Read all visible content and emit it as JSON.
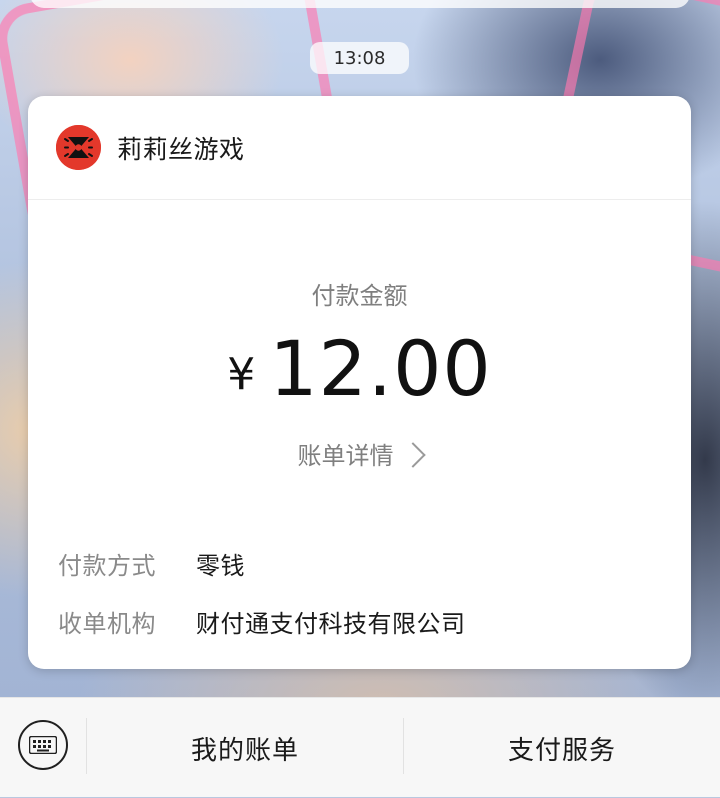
{
  "status": {
    "time": "13:08"
  },
  "card": {
    "merchant_name": "莉莉丝游戏",
    "amount_label": "付款金额",
    "currency_symbol": "¥",
    "amount": "12.00",
    "details_link": "账单详情",
    "rows": [
      {
        "label": "付款方式",
        "value": "零钱"
      },
      {
        "label": "收单机构",
        "value": "财付通支付科技有限公司"
      }
    ]
  },
  "bottom_bar": {
    "keyboard_icon": "keyboard-icon",
    "tab_bill": "我的账单",
    "tab_service": "支付服务"
  },
  "colors": {
    "accent_red": "#e3382b",
    "text_primary": "#111111",
    "text_secondary": "#7f7f7f"
  }
}
